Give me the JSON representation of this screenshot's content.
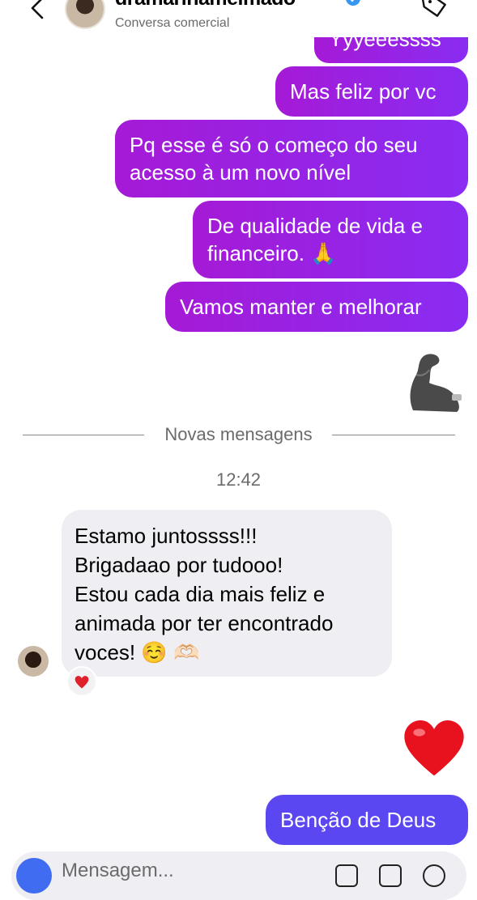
{
  "header": {
    "name": "dramarinamelmado",
    "subtitle": "Conversa comercial"
  },
  "messages_out_top": [
    {
      "text": "Yyyeeessss"
    },
    {
      "text": "Mas feliz por vc"
    },
    {
      "lines": [
        "Pq esse é só o começo do seu",
        "acesso à um novo nível"
      ]
    },
    {
      "lines": [
        "De qualidade de vida e",
        "financeiro. 🙏"
      ]
    },
    {
      "text": "Vamos manter e melhorar"
    }
  ],
  "divider": {
    "label": "Novas mensagens"
  },
  "timestamp": "12:42",
  "message_in": {
    "lines": [
      "Estamo juntossss!!!",
      "Brigadaao por tudooo!",
      "Estou cada dia mais feliz e",
      "animada por ter encontrado",
      "voces! ☺️ 🫶🏻"
    ]
  },
  "message_out_bottom": {
    "text": "Benção de Deus"
  },
  "composer": {
    "placeholder": "Mensagem..."
  },
  "colors": {
    "bubble_out": "#8a2cf2",
    "bubble_in": "#efeff3",
    "accent": "#3f6cf0"
  }
}
